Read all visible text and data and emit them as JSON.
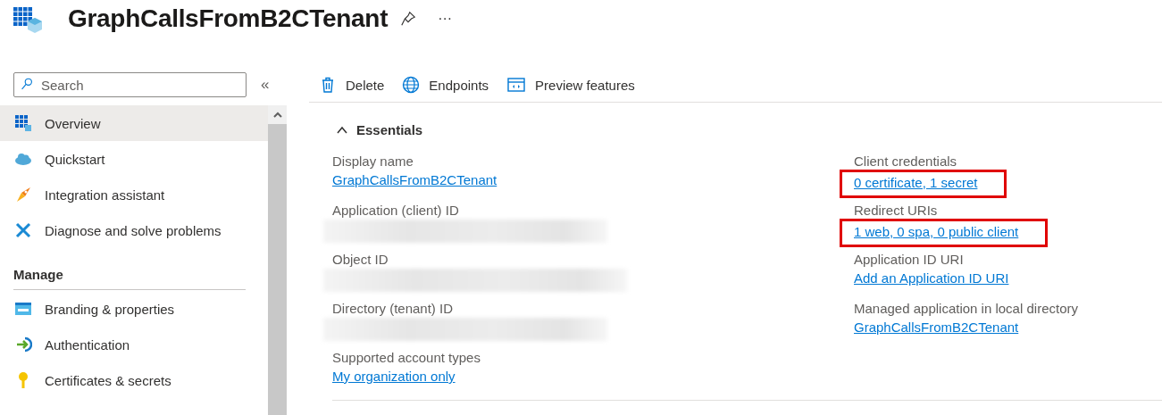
{
  "header": {
    "title": "GraphCallsFromB2CTenant",
    "more": "···"
  },
  "sidebar": {
    "search": {
      "placeholder": "Search"
    },
    "collapse": "«",
    "items": [
      {
        "label": "Overview",
        "selected": true
      },
      {
        "label": "Quickstart",
        "selected": false
      },
      {
        "label": "Integration assistant",
        "selected": false
      },
      {
        "label": "Diagnose and solve problems",
        "selected": false
      }
    ],
    "section": "Manage",
    "section_items": [
      {
        "label": "Branding & properties",
        "selected": false
      },
      {
        "label": "Authentication",
        "selected": false
      },
      {
        "label": "Certificates & secrets",
        "selected": false
      }
    ]
  },
  "toolbar": [
    {
      "label": "Delete"
    },
    {
      "label": "Endpoints"
    },
    {
      "label": "Preview features"
    }
  ],
  "essentials": {
    "title": "Essentials",
    "expanded": true,
    "left": [
      {
        "label": "Display name",
        "kind": "link",
        "value": "GraphCallsFromB2CTenant",
        "highlighted": false
      },
      {
        "label": "Application (client) ID",
        "kind": "redacted"
      },
      {
        "label": "Object ID",
        "kind": "redacted"
      },
      {
        "label": "Directory (tenant) ID",
        "kind": "redacted"
      },
      {
        "label": "Supported account types",
        "kind": "link",
        "value": "My organization only",
        "highlighted": false
      }
    ],
    "right": [
      {
        "label": "Client credentials",
        "kind": "link",
        "value": "0 certificate, 1 secret",
        "highlighted": true
      },
      {
        "label": "Redirect URIs",
        "kind": "link",
        "value": "1 web, 0 spa, 0 public client",
        "highlighted": true
      },
      {
        "label": "Application ID URI",
        "kind": "link",
        "value": "Add an Application ID URI",
        "highlighted": false
      },
      {
        "label": "Managed application in local directory",
        "kind": "link",
        "value": "GraphCallsFromB2CTenant",
        "highlighted": false
      }
    ]
  }
}
